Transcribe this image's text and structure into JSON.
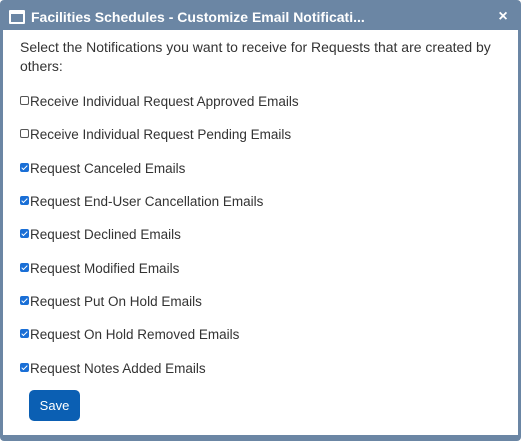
{
  "window": {
    "title": "Facilities Schedules - Customize Email Notificati...",
    "close_glyph": "×"
  },
  "intro": "Select the Notifications you want to receive for Requests that are created by others:",
  "options": [
    {
      "label": "Receive Individual Request Approved Emails",
      "checked": false
    },
    {
      "label": "Receive Individual Request Pending Emails",
      "checked": false
    },
    {
      "label": "Request Canceled Emails",
      "checked": true
    },
    {
      "label": "Request End-User Cancellation Emails",
      "checked": true
    },
    {
      "label": "Request Declined Emails",
      "checked": true
    },
    {
      "label": "Request Modified Emails",
      "checked": true
    },
    {
      "label": "Request Put On Hold Emails",
      "checked": true
    },
    {
      "label": "Request On Hold Removed Emails",
      "checked": true
    },
    {
      "label": "Request Notes Added Emails",
      "checked": true
    }
  ],
  "save_label": "Save"
}
